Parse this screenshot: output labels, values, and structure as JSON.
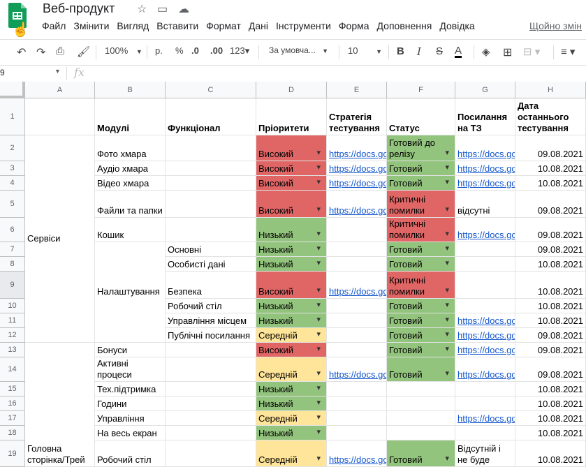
{
  "doc": {
    "title": "Веб-продукт"
  },
  "menu": [
    "Файл",
    "Змінити",
    "Вигляд",
    "Вставити",
    "Формат",
    "Дані",
    "Інструменти",
    "Форма",
    "Доповнення",
    "Довідка"
  ],
  "menu_last": "Щойно змін",
  "toolbar": {
    "zoom": "100%",
    "currency": "р.",
    "percent": "%",
    "dec_less": ".0",
    "dec_more": ".00",
    "more_formats": "123▾",
    "font": "За умовча...",
    "font_size": "10"
  },
  "namebox": {
    "value": "9"
  },
  "formula": {
    "fx": "fx"
  },
  "columns": [
    "A",
    "B",
    "C",
    "D",
    "E",
    "F",
    "G",
    "H"
  ],
  "rows": [
    "1",
    "2",
    "3",
    "4",
    "5",
    "6",
    "7",
    "8",
    "9",
    "10",
    "11",
    "12",
    "13",
    "14",
    "15",
    "16",
    "17",
    "18",
    "19"
  ],
  "header": {
    "b": "Модулі",
    "c": "Функціонал",
    "d": "Пріоритети",
    "e": "Стратегія тестування",
    "f": "Статус",
    "g": "Посилання на ТЗ",
    "h": "Дата останнього тестування"
  },
  "groups": {
    "services": "Сервіси",
    "home": "Головна сторінка/Трей"
  },
  "cells": {
    "r2": {
      "b": "Фото хмара",
      "d": "Високий",
      "e": "https://docs.go",
      "f": "Готовий до релізу",
      "g": "https://docs.go",
      "h": "09.08.2021"
    },
    "r3": {
      "b": "Аудіо хмара",
      "d": "Високий",
      "e": "https://docs.go",
      "f": "Готовий",
      "g": "https://docs.go",
      "h": "10.08.2021"
    },
    "r4": {
      "b": "Відео хмара",
      "d": "Високий",
      "e": "https://docs.go",
      "f": "Готовий",
      "g": "https://docs.go",
      "h": "10.08.2021"
    },
    "r5": {
      "b": "Файли та папки",
      "d": "Високий",
      "e": "https://docs.go",
      "f": "Критичні помилки",
      "g": "відсутні",
      "h": "09.08.2021"
    },
    "r6": {
      "b": "Кошик",
      "d": "Низький",
      "f": "Критичні помилки",
      "g": "https://docs.go",
      "h": "09.08.2021"
    },
    "r7": {
      "c": "Основні",
      "d": "Низький",
      "f": "Готовий",
      "h": "09.08.2021"
    },
    "r8": {
      "c": "Особисті дані",
      "d": "Низький",
      "f": "Готовий",
      "h": "10.08.2021"
    },
    "r9": {
      "c": "Безпека",
      "d": "Високий",
      "e": "https://docs.go",
      "f": "Критичні помилки",
      "h": "10.08.2021"
    },
    "r10": {
      "c": "Робочий стіл",
      "d": "Низький",
      "f": "Готовий",
      "h": "10.08.2021"
    },
    "r11": {
      "c": "Управління місцем",
      "d": "Низький",
      "f": "Готовий",
      "g": "https://docs.go",
      "h": "10.08.2021"
    },
    "r12": {
      "c": "Публічні посилання",
      "d": "Середній",
      "f": "Готовий",
      "g": "https://docs.go",
      "h": "09.08.2021"
    },
    "r13": {
      "b": "Бонуси",
      "d": "Високий",
      "f": "Готовий",
      "g": "https://docs.go",
      "h": "09.08.2021"
    },
    "r14": {
      "b": "Активні процеси",
      "d": "Середній",
      "e": "https://docs.go",
      "f": "Готовий",
      "g": "https://docs.go",
      "h": "09.08.2021"
    },
    "r15": {
      "b": "Тех.підтримка",
      "d": "Низький",
      "h": "10.08.2021"
    },
    "r16": {
      "b": "Години",
      "d": "Низький",
      "h": "10.08.2021"
    },
    "r17": {
      "b": "Управління",
      "d": "Середній",
      "g": "https://docs.go",
      "h": "10.08.2021"
    },
    "r18": {
      "b": "На весь екран",
      "d": "Низький",
      "h": "10.08.2021"
    },
    "r19": {
      "b": "Робочий стіл",
      "d": "Середній",
      "e": "https://docs.go",
      "f": "Готовий",
      "g": "Відсутній і не буде",
      "h": "10.08.2021"
    }
  },
  "settings_label": "Налаштування",
  "colors": {
    "high": "#e06666",
    "low": "#93c47d",
    "medium": "#ffe599",
    "ready": "#93c47d",
    "critical": "#e06666",
    "link": "#1155cc"
  }
}
